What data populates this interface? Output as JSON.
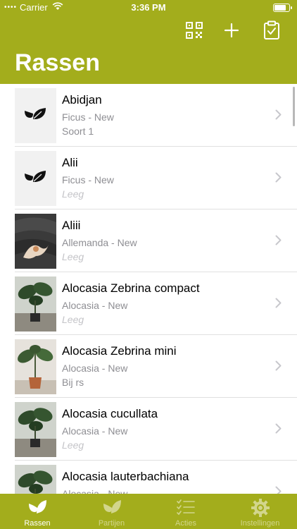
{
  "status_bar": {
    "carrier": "Carrier",
    "time": "3:36 PM",
    "battery_level": 0.85
  },
  "toolbar": {
    "icons": [
      "qr-code-icon",
      "plus-icon",
      "clipboard-check-icon"
    ]
  },
  "page": {
    "title": "Rassen"
  },
  "list": {
    "items": [
      {
        "name": "Abidjan",
        "subtitle": "Ficus - New",
        "extra": "Soort 1",
        "extra_placeholder": false,
        "thumb": "placeholder-leaf"
      },
      {
        "name": "Alii",
        "subtitle": "Ficus - New",
        "extra": "Leeg",
        "extra_placeholder": true,
        "thumb": "placeholder-leaf"
      },
      {
        "name": "Aliii",
        "subtitle": "Allemanda - New",
        "extra": "Leeg",
        "extra_placeholder": true,
        "thumb": "photo-dark"
      },
      {
        "name": "Alocasia Zebrina compact",
        "subtitle": "Alocasia - New",
        "extra": "Leeg",
        "extra_placeholder": true,
        "thumb": "photo-plant"
      },
      {
        "name": "Alocasia Zebrina mini",
        "subtitle": "Alocasia - New",
        "extra": "Bij rs",
        "extra_placeholder": false,
        "thumb": "photo-plant-light"
      },
      {
        "name": "Alocasia cucullata",
        "subtitle": "Alocasia - New",
        "extra": "Leeg",
        "extra_placeholder": true,
        "thumb": "photo-plant"
      },
      {
        "name": "Alocasia lauterbachiana",
        "subtitle": "Alocasia - New",
        "extra": "",
        "extra_placeholder": true,
        "thumb": "photo-plant"
      }
    ]
  },
  "tabbar": {
    "tabs": [
      {
        "label": "Rassen",
        "icon": "leaf-icon",
        "active": true
      },
      {
        "label": "Partijen",
        "icon": "leaves-icon",
        "active": false
      },
      {
        "label": "Acties",
        "icon": "checklist-icon",
        "active": false
      },
      {
        "label": "Instellingen",
        "icon": "gear-icon",
        "active": false
      }
    ]
  },
  "colors": {
    "brand": "#a3ad1c",
    "secondary_text": "#8e8e93",
    "placeholder_text": "#c4c4c8",
    "inactive_tab": "#d2d68c"
  }
}
